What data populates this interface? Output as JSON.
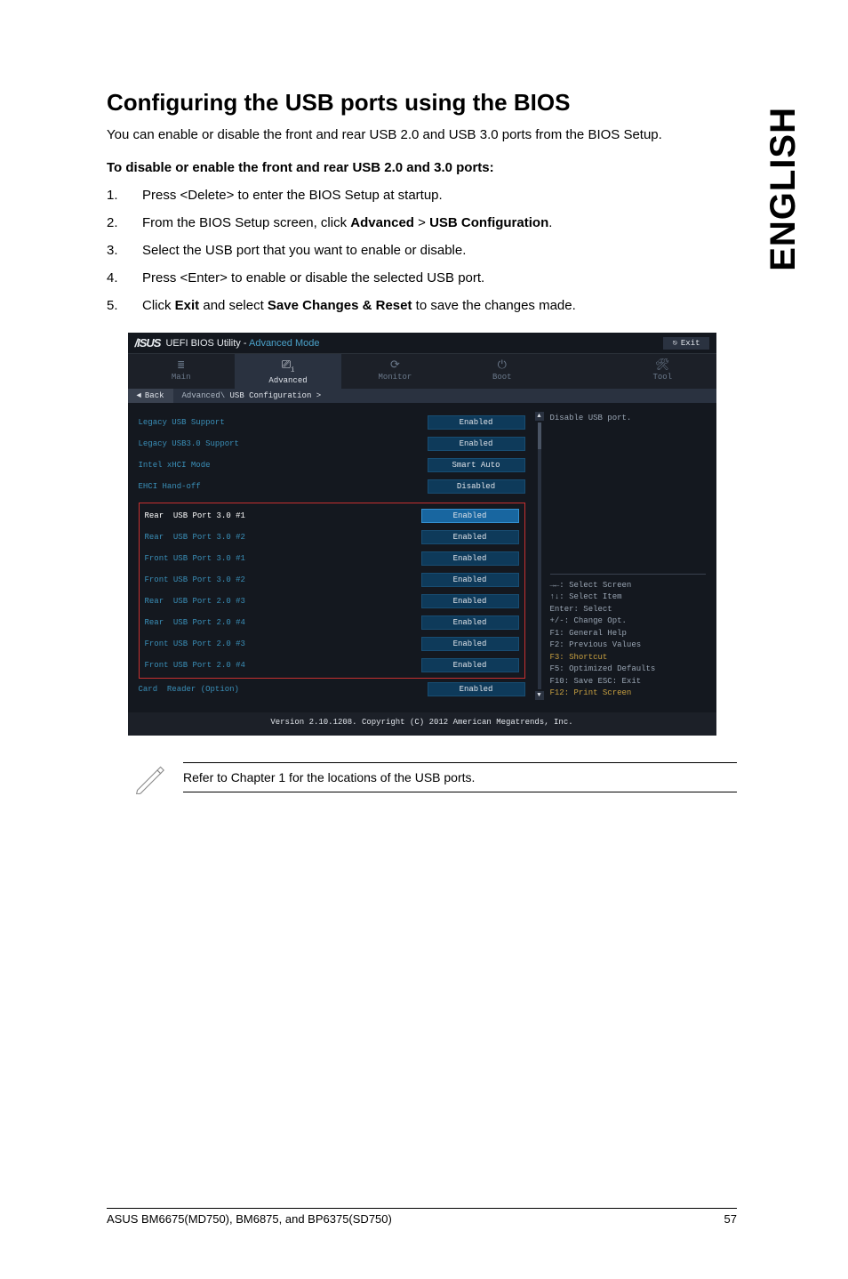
{
  "lang_label": "ENGLISH",
  "heading": "Configuring the USB ports using the BIOS",
  "intro": "You can enable or disable the front and rear USB 2.0 and USB 3.0 ports from the BIOS Setup.",
  "subhead": "To disable or enable the front and rear USB 2.0 and 3.0 ports:",
  "steps": [
    {
      "n": "1.",
      "t_pre": "Press <Delete> to enter the BIOS Setup at startup.",
      "bold": []
    },
    {
      "n": "2.",
      "t": "From the BIOS Setup screen, click ",
      "b1": "Advanced",
      "mid": " > ",
      "b2": "USB Configuration",
      "end": "."
    },
    {
      "n": "3.",
      "t_pre": "Select the USB port that you want to enable or disable."
    },
    {
      "n": "4.",
      "t_pre": "Press <Enter> to enable or disable the selected USB port."
    },
    {
      "n": "5.",
      "t": "Click ",
      "b1": "Exit",
      "mid": " and select ",
      "b2": "Save Changes & Reset",
      "end": " to save the changes made."
    }
  ],
  "bios": {
    "title_prefix": "UEFI BIOS Utility - ",
    "title_mode": "Advanced Mode",
    "exit": "Exit",
    "tabs": [
      {
        "icon": "≣",
        "label": "Main"
      },
      {
        "icon": "⚙",
        "label": "Advanced"
      },
      {
        "icon": "⟳",
        "label": "Monitor"
      },
      {
        "icon": "⏻",
        "label": "Boot"
      },
      {
        "icon": "≡",
        "label": "",
        "hidden": true
      },
      {
        "icon": "🛠",
        "label": "Tool"
      }
    ],
    "back": "Back",
    "breadcrumb_pre": "Advanced\\ ",
    "breadcrumb_cur": "USB Configuration >",
    "plain_rows": [
      {
        "label": "Legacy USB Support",
        "val": "Enabled"
      },
      {
        "label": "Legacy USB3.0 Support",
        "val": "Enabled"
      },
      {
        "label": "Intel xHCI Mode",
        "val": "Smart Auto"
      },
      {
        "label": "EHCI Hand-off",
        "val": "Disabled"
      }
    ],
    "red_rows": [
      {
        "label": "Rear  USB Port 3.0 #1",
        "val": "Enabled",
        "sel": true
      },
      {
        "label": "Rear  USB Port 3.0 #2",
        "val": "Enabled"
      },
      {
        "label": "Front USB Port 3.0 #1",
        "val": "Enabled"
      },
      {
        "label": "Front USB Port 3.0 #2",
        "val": "Enabled"
      },
      {
        "label": "Rear  USB Port 2.0 #3",
        "val": "Enabled"
      },
      {
        "label": "Rear  USB Port 2.0 #4",
        "val": "Enabled"
      },
      {
        "label": "Front USB Port 2.0 #3",
        "val": "Enabled"
      },
      {
        "label": "Front USB Port 2.0 #4",
        "val": "Enabled"
      }
    ],
    "extra_row": {
      "label": "Card  Reader (Option)",
      "val": "Enabled"
    },
    "help_top": "Disable USB port.",
    "help_lines": [
      {
        "t": "→←: Select Screen"
      },
      {
        "t": "↑↓: Select Item"
      },
      {
        "t": "Enter: Select"
      },
      {
        "t": "+/-: Change Opt."
      },
      {
        "t": "F1: General Help"
      },
      {
        "t": "F2: Previous Values"
      },
      {
        "t": "F3: Shortcut",
        "hl": true
      },
      {
        "t": "F5: Optimized Defaults"
      },
      {
        "t": "F10: Save  ESC: Exit"
      },
      {
        "t": "F12: Print Screen",
        "hl": true
      }
    ],
    "version": "Version 2.10.1208. Copyright (C) 2012 American Megatrends, Inc."
  },
  "note": "Refer to Chapter 1 for the locations of the USB ports.",
  "footer_left": "ASUS BM6675(MD750), BM6875, and BP6375(SD750)",
  "footer_right": "57"
}
